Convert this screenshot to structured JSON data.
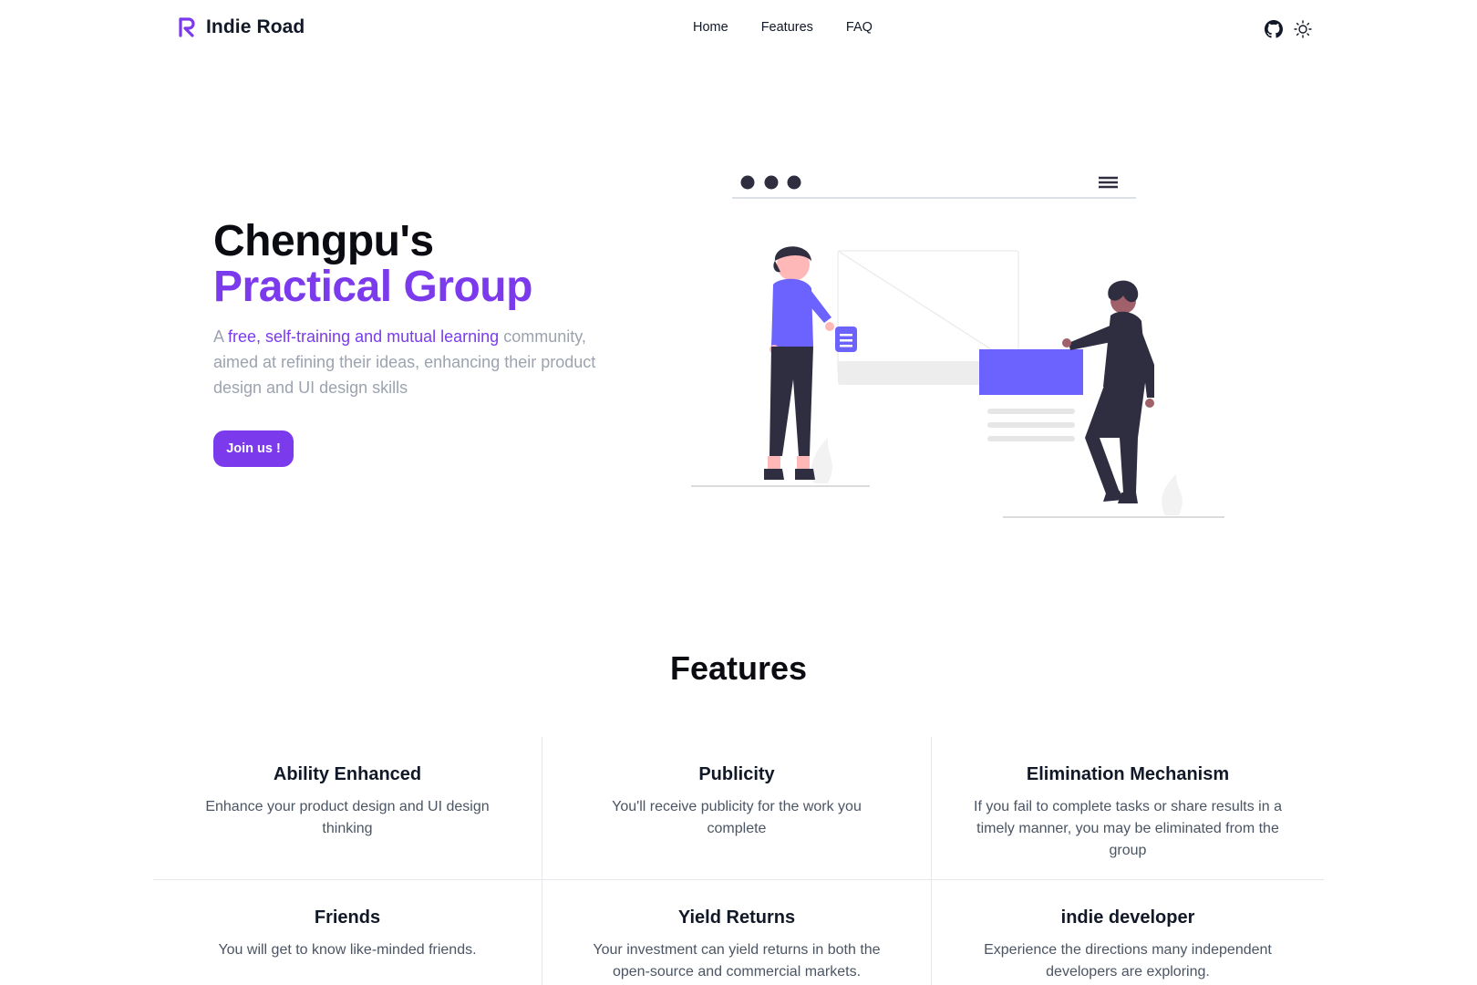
{
  "header": {
    "brand": "Indie Road",
    "nav": [
      "Home",
      "Features",
      "FAQ"
    ],
    "icons": [
      "github-icon",
      "sun-icon"
    ]
  },
  "hero": {
    "title_line1": "Chengpu's",
    "title_line2": "Practical Group",
    "desc_prefix": "A ",
    "desc_accent": "free, self-training and mutual learning",
    "desc_rest": " community, aimed at refining their ideas, enhancing their product design and UI design skills",
    "cta": "Join us !"
  },
  "features": {
    "title": "Features",
    "items": [
      {
        "title": "Ability Enhanced",
        "desc": "Enhance your product design and UI design thinking"
      },
      {
        "title": "Publicity",
        "desc": "You'll receive publicity for the work you complete"
      },
      {
        "title": "Elimination Mechanism",
        "desc": "If you fail to complete tasks or share results in a timely manner, you may be eliminated from the group"
      },
      {
        "title": "Friends",
        "desc": "You will get to know like-minded friends."
      },
      {
        "title": "Yield Returns",
        "desc": "Your investment can yield returns in both the open-source and commercial markets."
      },
      {
        "title": "indie developer",
        "desc": "Experience the directions many independent developers are exploring."
      }
    ]
  },
  "colors": {
    "accent": "#7c3aed",
    "illustration_accent": "#6c63ff",
    "dark": "#2f2e41"
  }
}
